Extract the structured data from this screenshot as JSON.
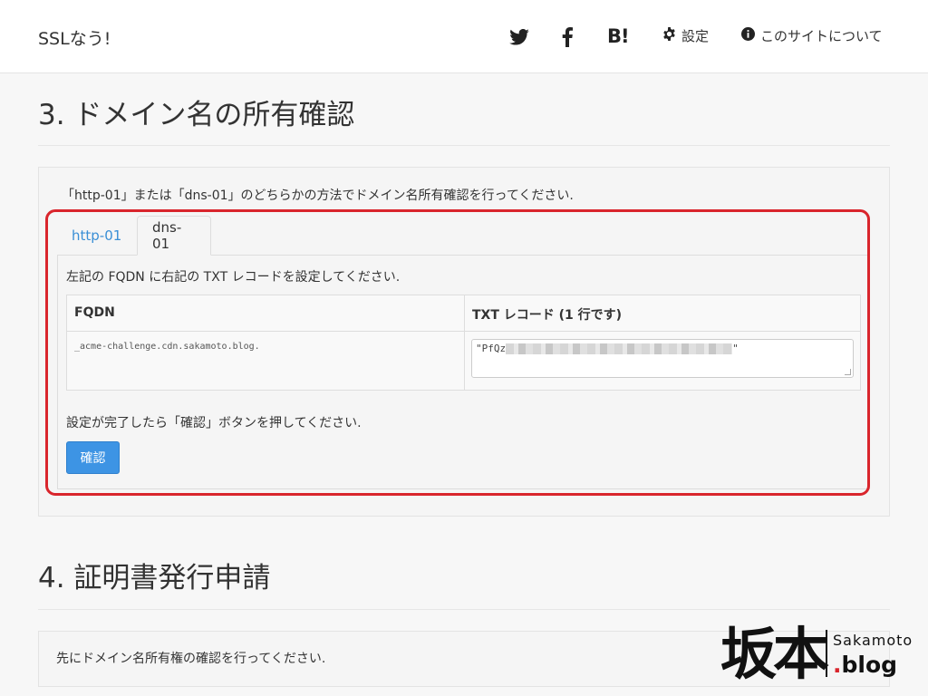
{
  "navbar": {
    "brand": "SSLなう!",
    "hatena_label": "B!",
    "settings_label": "設定",
    "about_label": "このサイトについて"
  },
  "section3": {
    "title": "3. ドメイン名の所有確認",
    "intro": "「http-01」または「dns-01」のどちらかの方法でドメイン名所有確認を行ってください.",
    "tabs": [
      {
        "label": "http-01",
        "active": false
      },
      {
        "label": "dns-01",
        "active": true
      }
    ],
    "instruction": "左記の FQDN に右記の TXT レコードを設定してください.",
    "table": {
      "headers": [
        "FQDN",
        "TXT レコード (1 行です)"
      ],
      "fqdn": "_acme-challenge.cdn.sakamoto.blog.",
      "txt_prefix": "\"PfQz",
      "txt_suffix": "\""
    },
    "after_text": "設定が完了したら「確認」ボタンを押してください.",
    "confirm_button": "確認"
  },
  "section4": {
    "title": "4. 証明書発行申請",
    "notice": "先にドメイン名所有権の確認を行ってください."
  },
  "watermark": {
    "kanji": "坂本",
    "top": "Sakamoto",
    "dot": ".",
    "bottom": "blog"
  },
  "colors": {
    "link": "#3a8fd6",
    "primary_button": "#3d94e4",
    "highlight": "#d9252c"
  }
}
